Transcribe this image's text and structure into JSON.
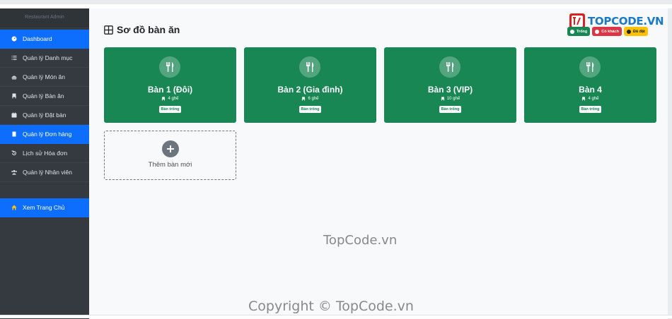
{
  "sidebar": {
    "brand": "Restaurant Admin",
    "items": [
      {
        "label": "Dashboard",
        "icon": "dashboard-icon",
        "active": true
      },
      {
        "label": "Quản lý Danh mục",
        "icon": "list-icon",
        "active": false
      },
      {
        "label": "Quản lý Món ăn",
        "icon": "food-icon",
        "active": false
      },
      {
        "label": "Quản lý Bàn ăn",
        "icon": "chair-icon",
        "active": false
      },
      {
        "label": "Quản lý Đặt bàn",
        "icon": "calendar-icon",
        "active": false
      },
      {
        "label": "Quản lý Đơn hàng",
        "icon": "order-icon",
        "active": true
      },
      {
        "label": "Lịch sử Hóa đơn",
        "icon": "history-icon",
        "active": false
      },
      {
        "label": "Quản lý Nhân viên",
        "icon": "users-icon",
        "active": false
      }
    ],
    "home_link": {
      "label": "Xem Trang Chủ",
      "icon": "home-icon"
    }
  },
  "header": {
    "title": "Sơ đồ bàn ăn",
    "title_icon": "table-grid-icon",
    "legend": [
      {
        "label": "Trống",
        "color": "#198754"
      },
      {
        "label": "Có khách",
        "color": "#dc3545"
      },
      {
        "label": "Đã đặt",
        "color": "#ffc107"
      }
    ]
  },
  "logo": {
    "text": "TOPCODE.VN"
  },
  "tables": [
    {
      "name": "Bàn 1 (Đôi)",
      "seats": "4 ghế",
      "status": "Bàn trống"
    },
    {
      "name": "Bàn 2 (Gia đình)",
      "seats": "6 ghế",
      "status": "Bàn trống"
    },
    {
      "name": "Bàn 3 (VIP)",
      "seats": "10 ghế",
      "status": "Bàn trống"
    },
    {
      "name": "Bàn 4",
      "seats": "4 ghế",
      "status": "Bàn trống"
    }
  ],
  "add_table": {
    "label": "Thêm bàn mới"
  },
  "watermarks": {
    "center": "TopCode.vn",
    "bottom": "Copyright © TopCode.vn"
  },
  "colors": {
    "sidebar_bg": "#343a40",
    "active_item": "#0d6efd",
    "table_card": "#198754",
    "page_bg": "#f8f9fa"
  }
}
